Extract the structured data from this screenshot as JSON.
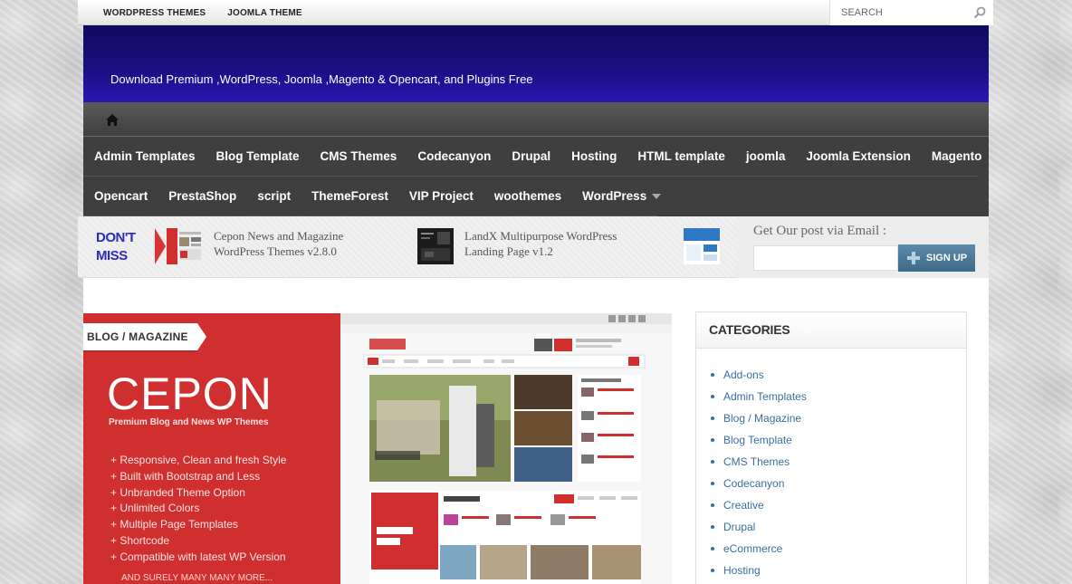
{
  "topbar": {
    "links": [
      "WORDPRESS THEMES",
      "JOOMLA THEME"
    ],
    "search_placeholder": "SEARCH"
  },
  "header": {
    "tagline": "Download Premium ,WordPress, Joomla ,Magento & Opencart, and Plugins Free",
    "background_color": "#1b0f86"
  },
  "nav": {
    "row1": [
      "Admin Templates",
      "Blog Template",
      "CMS Themes",
      "Codecanyon",
      "Drupal",
      "Hosting",
      "HTML template",
      "joomla",
      "Joomla Extension",
      "Magento"
    ],
    "row2": [
      "Opencart",
      "PrestaShop",
      "script",
      "ThemeForest",
      "VIP Project",
      "woothemes",
      "WordPress"
    ]
  },
  "dont_miss": {
    "label_line1": "DON'T",
    "label_line2": "MISS",
    "items": [
      {
        "title_line1": "Cepon News and Magazine",
        "title_line2": "WordPress Themes v2.8.0"
      },
      {
        "title_line1": "LandX Multipurpose WordPress",
        "title_line2": "Landing Page v1.2"
      }
    ]
  },
  "email_signup": {
    "label": "Get Our post via Email :",
    "button_label": "SIGN UP"
  },
  "feature": {
    "badge": "BLOG / MAGAZINE",
    "logo_text": "CEPON",
    "subtitle": "Premium Blog and News WP Themes",
    "bullets": [
      "Responsive, Clean and fresh Style",
      "Built with Bootstrap and Less",
      "Unbranded Theme Option",
      "Unlimited Colors",
      "Multiple Page Templates",
      "Shortcode",
      "Compatible with latest WP Version"
    ],
    "more": "AND SURELY MANY MANY MORE..."
  },
  "sidebar": {
    "title": "CATEGORIES",
    "categories": [
      "Add-ons",
      "Admin Templates",
      "Blog / Magazine",
      "Blog Template",
      "CMS Themes",
      "Codecanyon",
      "Creative",
      "Drupal",
      "eCommerce",
      "Hosting"
    ]
  },
  "colors": {
    "nav_bg": "#3f3f3f",
    "accent_red": "#cf2f2f",
    "link_blue": "#3a6da0",
    "dont_miss_blue": "#2c2ab8"
  }
}
